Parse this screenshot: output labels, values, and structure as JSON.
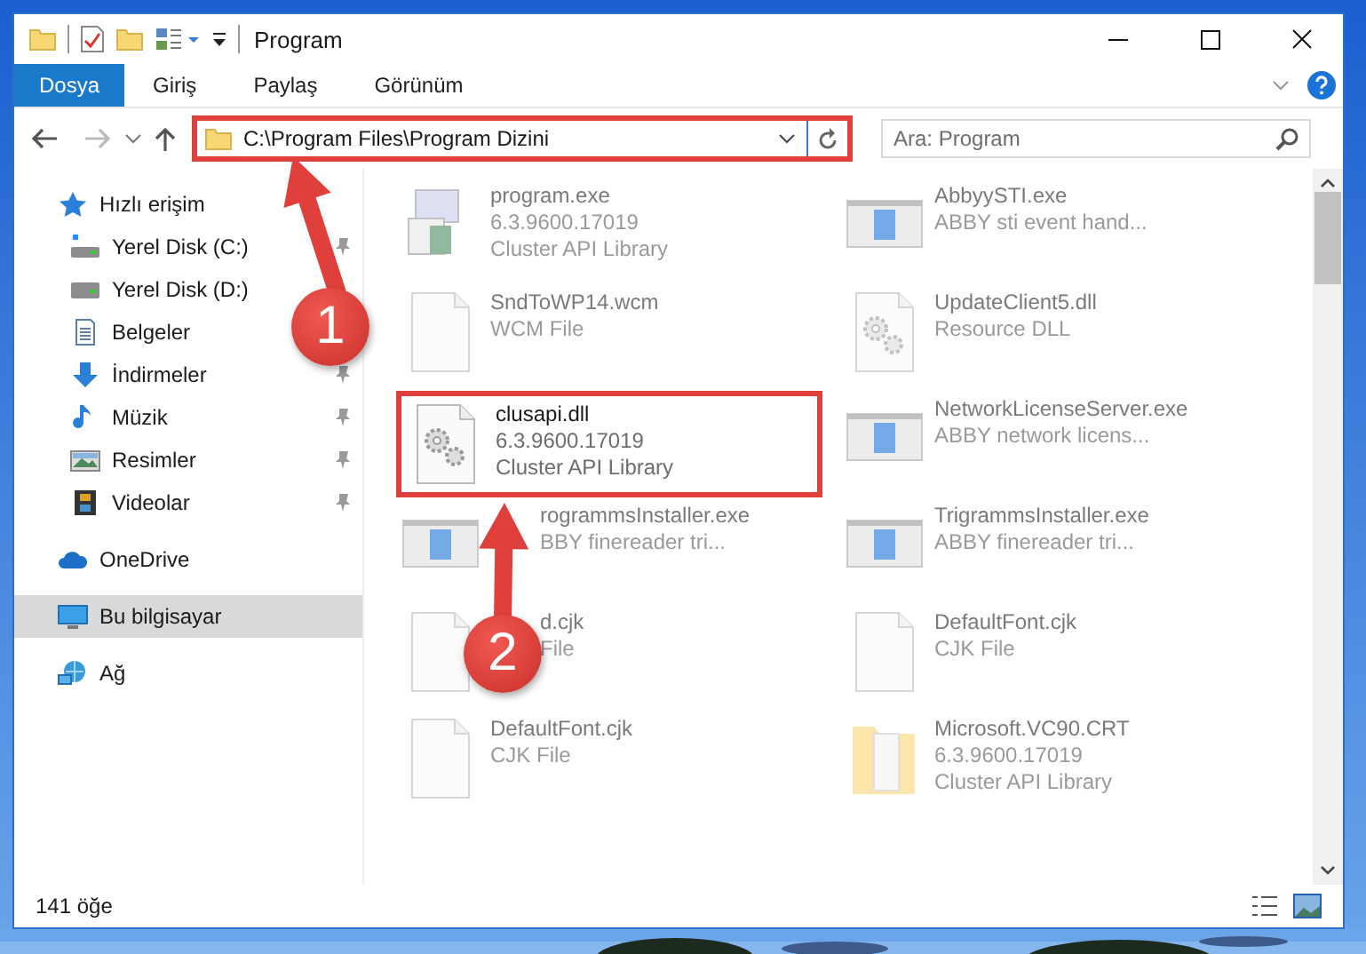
{
  "window": {
    "title": "Program"
  },
  "ribbon_tabs": [
    {
      "label": "Dosya",
      "kind": "file"
    },
    {
      "label": "Giriş",
      "kind": "tab"
    },
    {
      "label": "Paylaş",
      "kind": "tab"
    },
    {
      "label": "Görünüm",
      "kind": "tab"
    }
  ],
  "address_bar": {
    "path": "C:\\Program Files\\Program Dizini",
    "highlighted": true
  },
  "search": {
    "placeholder": "Ara: Program"
  },
  "sidebar": {
    "items": [
      {
        "label": "Hızlı erişim",
        "kind": "star",
        "selected": false,
        "children": [
          {
            "label": "Yerel Disk (C:)",
            "kind": "system-drive",
            "pinned": true
          },
          {
            "label": "Yerel Disk (D:)",
            "kind": "drive"
          },
          {
            "label": "Belgeler",
            "kind": "documents"
          },
          {
            "label": "İndirmeler",
            "kind": "download",
            "pinned": true
          },
          {
            "label": "Müzik",
            "kind": "music",
            "pinned": true
          },
          {
            "label": "Resimler",
            "kind": "pictures",
            "pinned": true
          },
          {
            "label": "Videolar",
            "kind": "film",
            "pinned": true
          }
        ]
      },
      {
        "label": "OneDrive",
        "kind": "cloud",
        "selected": false
      },
      {
        "label": "Bu bilgisayar",
        "kind": "computer",
        "selected": true
      },
      {
        "label": "Ağ",
        "kind": "network",
        "selected": false
      }
    ]
  },
  "files": [
    {
      "name": "program.exe",
      "lines": [
        "6.3.9600.17019",
        "Cluster API Library"
      ],
      "kind": "setup",
      "blurred": true,
      "covered": false,
      "highlighted": false
    },
    {
      "name": "AbbyySTI.exe",
      "lines": [
        "ABBY sti event hand..."
      ],
      "kind": "window",
      "blurred": true,
      "covered": false,
      "highlighted": false
    },
    {
      "name": "SndToWP14.wcm",
      "lines": [
        "WCM File"
      ],
      "kind": "blank",
      "blurred": true,
      "covered": false,
      "highlighted": false
    },
    {
      "name": "UpdateClient5.dll",
      "lines": [
        "Resource DLL"
      ],
      "kind": "gear",
      "blurred": true,
      "covered": false,
      "highlighted": false
    },
    {
      "name": "clusapi.dll",
      "lines": [
        "6.3.9600.17019",
        "Cluster API Library"
      ],
      "kind": "gear",
      "blurred": false,
      "covered": false,
      "highlighted": true
    },
    {
      "name": "NetworkLicenseServer.exe",
      "lines": [
        "ABBY network licens..."
      ],
      "kind": "window",
      "blurred": true,
      "covered": false,
      "highlighted": false
    },
    {
      "name": "rogrammsInstaller.exe",
      "lines": [
        "BBY finereader tri..."
      ],
      "kind": "window",
      "blurred": true,
      "covered": true,
      "highlighted": false
    },
    {
      "name": "TrigrammsInstaller.exe",
      "lines": [
        "ABBY finereader tri..."
      ],
      "kind": "window",
      "blurred": true,
      "covered": false,
      "highlighted": false
    },
    {
      "name": "d.cjk",
      "lines": [
        "File"
      ],
      "kind": "blank",
      "blurred": true,
      "covered": true,
      "highlighted": false
    },
    {
      "name": "DefaultFont.cjk",
      "lines": [
        "CJK File"
      ],
      "kind": "blank",
      "blurred": true,
      "covered": false,
      "highlighted": false
    },
    {
      "name": "DefaultFont.cjk",
      "lines": [
        "CJK File"
      ],
      "kind": "blank",
      "blurred": true,
      "covered": false,
      "highlighted": false
    },
    {
      "name": "Microsoft.VC90.CRT",
      "lines": [
        "6.3.9600.17019",
        "Cluster API Library"
      ],
      "kind": "folder",
      "blurred": true,
      "covered": false,
      "highlighted": false
    }
  ],
  "status_bar": {
    "item_count": "141 öğe"
  },
  "annotations": [
    {
      "number": "1"
    },
    {
      "number": "2"
    }
  ]
}
